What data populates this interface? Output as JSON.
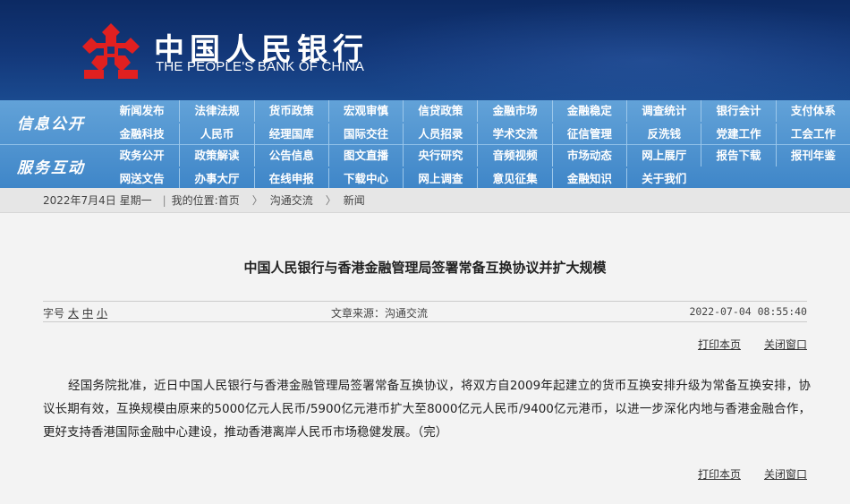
{
  "header": {
    "bank_name_cn": "中国人民银行",
    "bank_name_en": "THE PEOPLE'S BANK OF CHINA",
    "logo_color": "#e02020"
  },
  "nav": {
    "section1_label": "信息公开",
    "section2_label": "服务互动",
    "row1": [
      "新闻发布",
      "法律法规",
      "货币政策",
      "宏观审慎",
      "信贷政策",
      "金融市场",
      "金融稳定",
      "调查统计",
      "银行会计",
      "支付体系"
    ],
    "row2": [
      "金融科技",
      "人民币",
      "经理国库",
      "国际交往",
      "人员招录",
      "学术交流",
      "征信管理",
      "反洗钱",
      "党建工作",
      "工会工作"
    ],
    "row3": [
      "政务公开",
      "政策解读",
      "公告信息",
      "图文直播",
      "央行研究",
      "音频视频",
      "市场动态",
      "网上展厅",
      "报告下载",
      "报刊年鉴"
    ],
    "row4": [
      "网送文告",
      "办事大厅",
      "在线申报",
      "下载中心",
      "网上调查",
      "意见征集",
      "金融知识",
      "关于我们"
    ]
  },
  "breadcrumb": {
    "date": "2022年7月4日 星期一",
    "divider": "|",
    "location_label": "我的位置:首页",
    "arrow": "〉",
    "level2": "沟通交流",
    "level3": "新闻"
  },
  "article": {
    "title": "中国人民银行与香港金融管理局签署常备互换协议并扩大规模",
    "font_size_label": "字号",
    "font_large": "大",
    "font_medium": "中",
    "font_small": "小",
    "source": "文章来源：沟通交流",
    "datetime": "2022-07-04  08:55:40",
    "print_label": "打印本页",
    "close_label": "关闭窗口",
    "body": "经国务院批准，近日中国人民银行与香港金融管理局签署常备互换协议，将双方自2009年起建立的货币互换安排升级为常备互换安排，协议长期有效，互换规模由原来的5000亿元人民币/5900亿元港币扩大至8000亿元人民币/9400亿元港币，以进一步深化内地与香港金融合作，更好支持香港国际金融中心建设，推动香港离岸人民币市场稳健发展。（完）"
  }
}
